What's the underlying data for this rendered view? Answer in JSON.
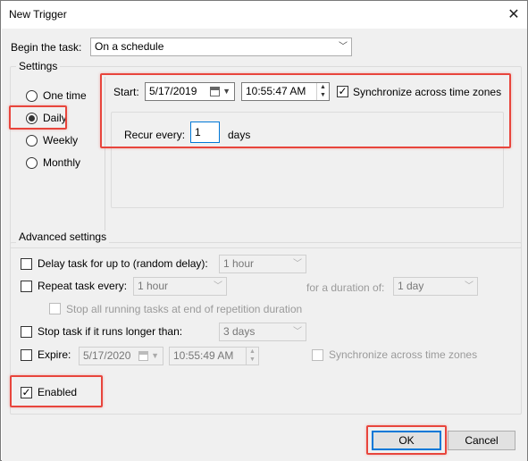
{
  "window": {
    "title": "New Trigger",
    "close_glyph": "✕"
  },
  "begin_task": {
    "label": "Begin the task:",
    "value": "On a schedule"
  },
  "settings": {
    "group_title": "Settings",
    "options": [
      {
        "label": "One time",
        "checked": false
      },
      {
        "label": "Daily",
        "checked": true
      },
      {
        "label": "Weekly",
        "checked": false
      },
      {
        "label": "Monthly",
        "checked": false
      }
    ],
    "start_label": "Start:",
    "start_date": "5/17/2019",
    "start_time": "10:55:47 AM",
    "sync_label": "Synchronize across time zones",
    "sync_checked": true,
    "recur_label": "Recur every:",
    "recur_value": "1",
    "recur_unit": "days"
  },
  "advanced": {
    "group_title": "Advanced settings",
    "delay_label": "Delay task for up to (random delay):",
    "delay_value": "1 hour",
    "repeat_label": "Repeat task every:",
    "repeat_value": "1 hour",
    "duration_label": "for a duration of:",
    "duration_value": "1 day",
    "stop_running_label": "Stop all running tasks at end of repetition duration",
    "stop_longer_label": "Stop task if it runs longer than:",
    "stop_longer_value": "3 days",
    "expire_label": "Expire:",
    "expire_date": "5/17/2020",
    "expire_time": "10:55:49 AM",
    "expire_sync_label": "Synchronize across time zones",
    "enabled_label": "Enabled",
    "enabled_checked": true
  },
  "buttons": {
    "ok": "OK",
    "cancel": "Cancel"
  },
  "colors": {
    "highlight": "#e8453c",
    "primary_button_border": "#0078d7"
  }
}
